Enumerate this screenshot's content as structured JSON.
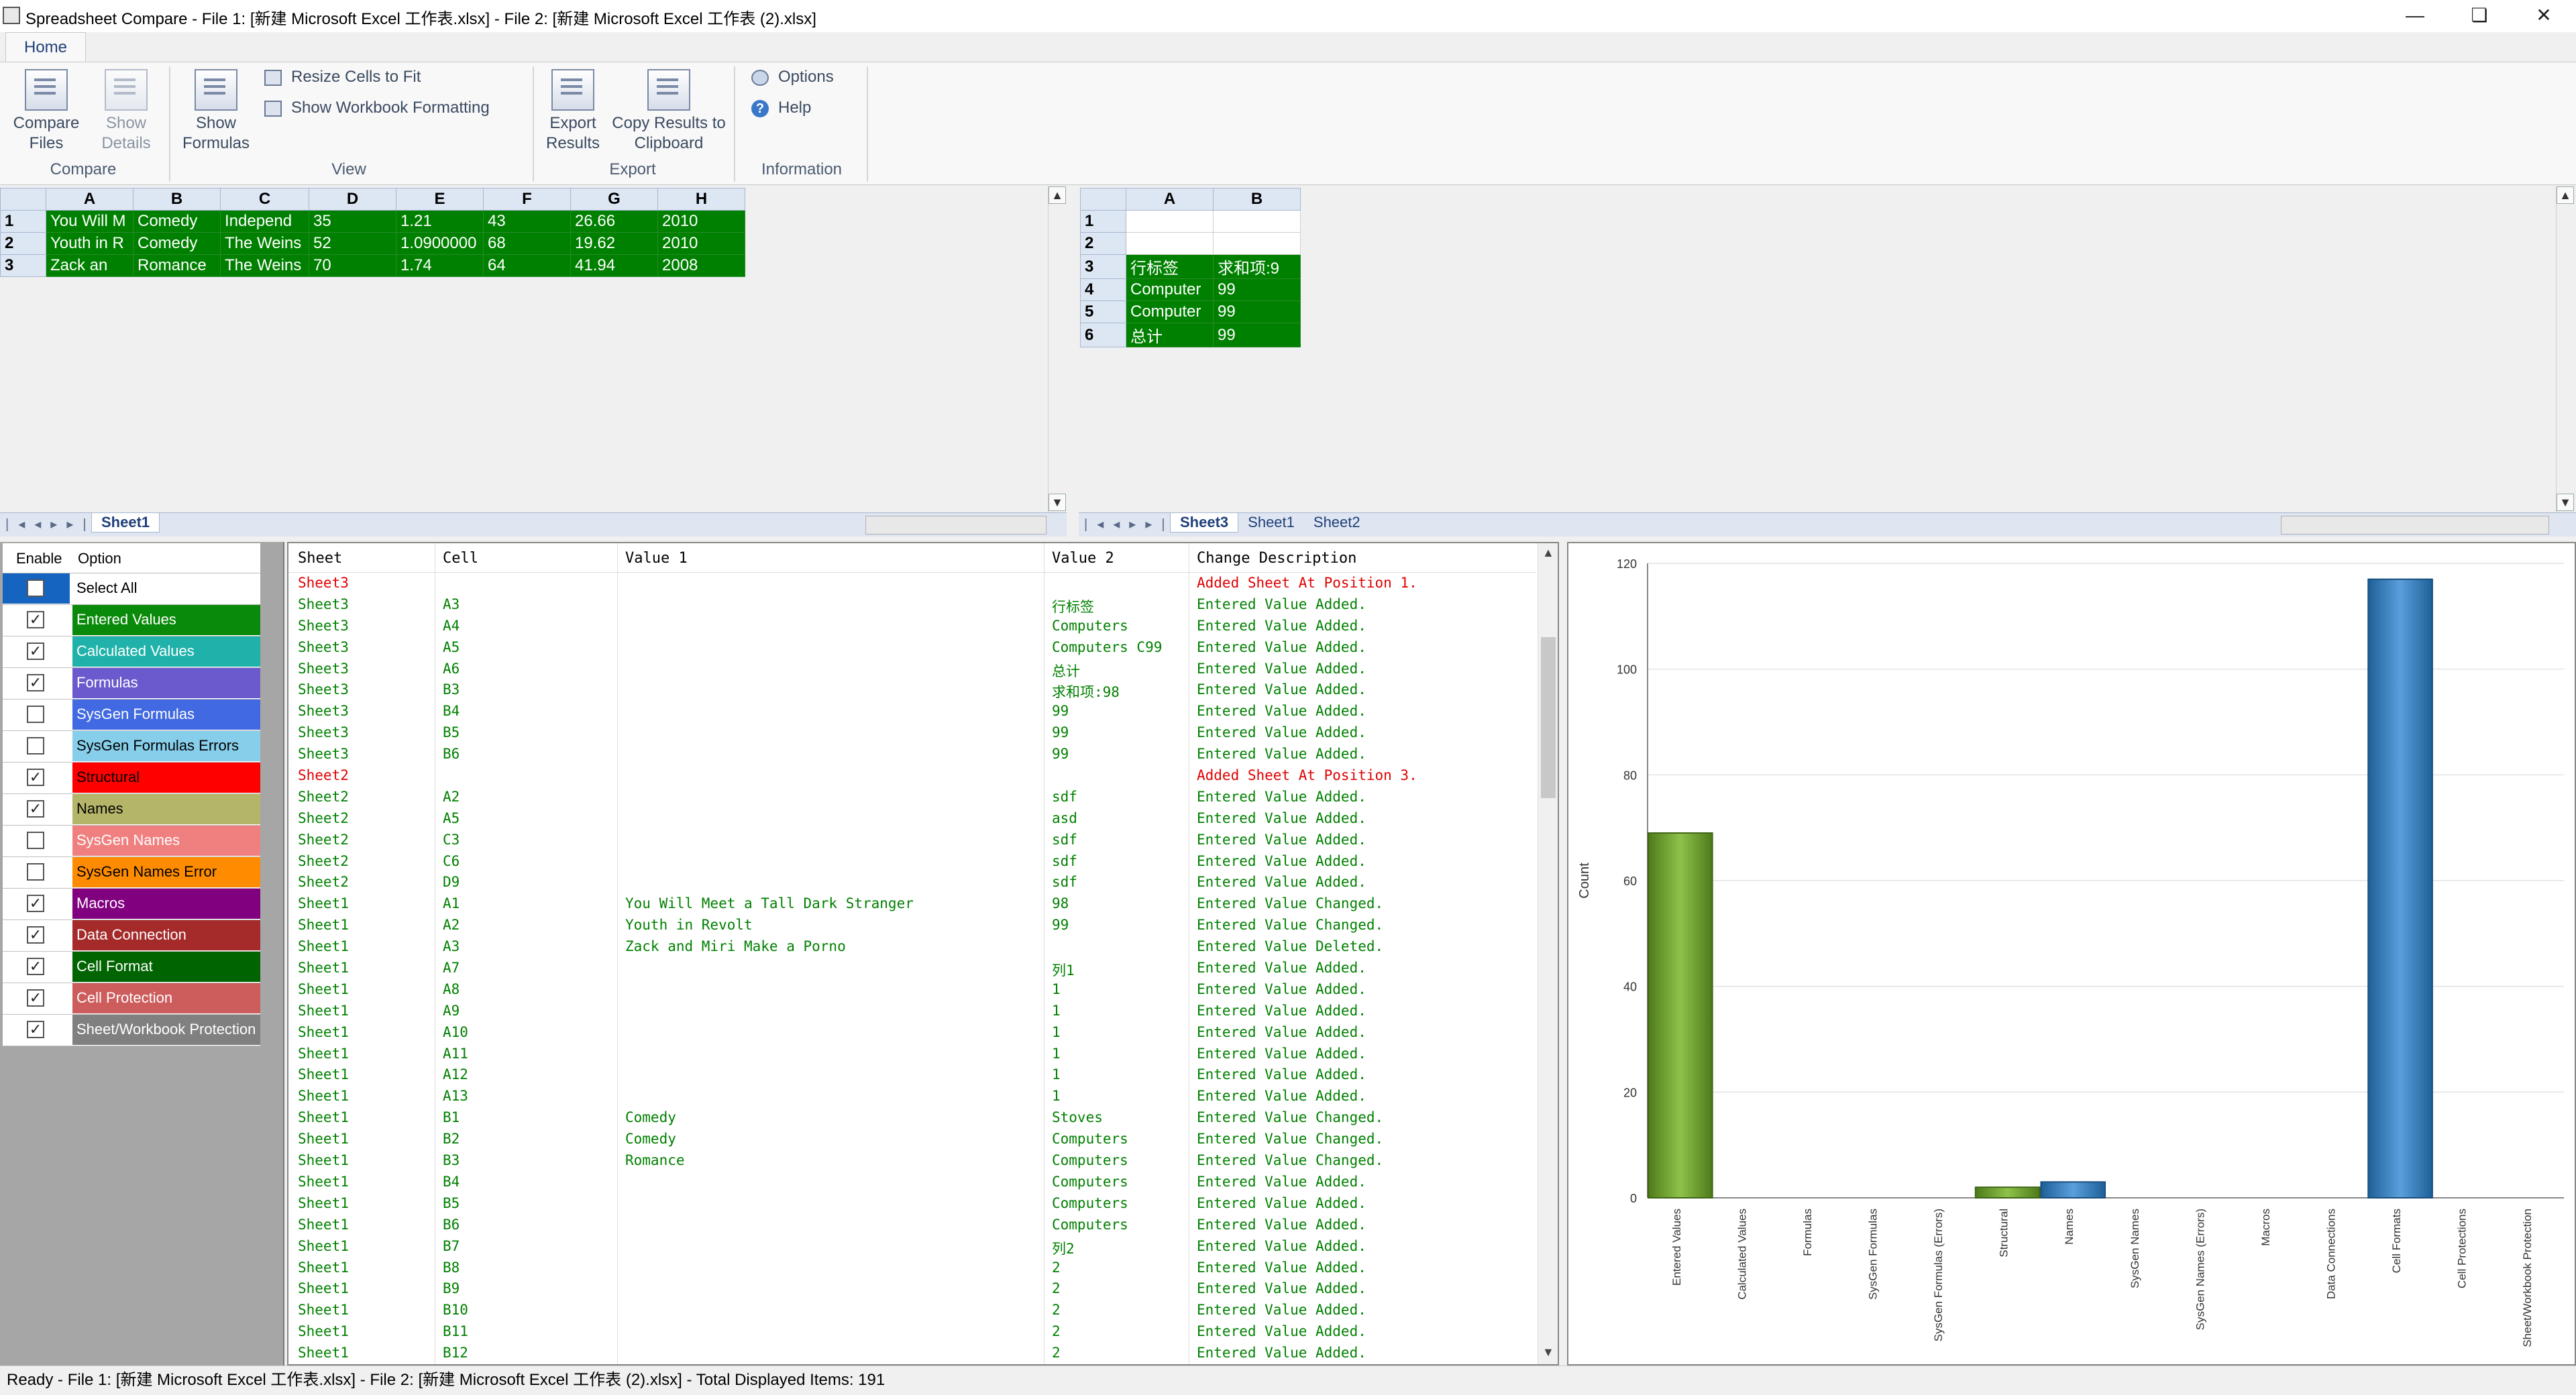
{
  "window": {
    "title": "Spreadsheet Compare - File 1: [新建 Microsoft Excel 工作表.xlsx] - File 2: [新建 Microsoft Excel 工作表 (2).xlsx]"
  },
  "ribbon": {
    "tab": "Home",
    "compare_files": "Compare Files",
    "show_details": "Show Details",
    "show_formulas": "Show Formulas",
    "resize_cells": "Resize Cells to Fit",
    "show_workbook_formatting": "Show Workbook Formatting",
    "export_results": "Export Results",
    "copy_results": "Copy Results to Clipboard",
    "options": "Options",
    "help": "Help",
    "groups": {
      "compare": "Compare",
      "view": "View",
      "export": "Export",
      "information": "Information"
    }
  },
  "left_grid": {
    "columns": [
      "A",
      "B",
      "C",
      "D",
      "E",
      "F",
      "G",
      "H"
    ],
    "rows": [
      {
        "n": "1",
        "cells": [
          "You Will M",
          "Comedy",
          "Independ",
          "35",
          "1.21",
          "43",
          "26.66",
          "2010"
        ]
      },
      {
        "n": "2",
        "cells": [
          "Youth in R",
          "Comedy",
          "The Weins",
          "52",
          "1.0900000",
          "68",
          "19.62",
          "2010"
        ]
      },
      {
        "n": "3",
        "cells": [
          "Zack an",
          "Romance",
          "The Weins",
          "70",
          "1.74",
          "64",
          "41.94",
          "2008"
        ]
      }
    ],
    "tabs": [
      "Sheet1"
    ]
  },
  "right_grid": {
    "columns": [
      "A",
      "B"
    ],
    "rows": [
      {
        "n": "1",
        "cells": [
          "",
          ""
        ],
        "hl": false
      },
      {
        "n": "2",
        "cells": [
          "",
          ""
        ],
        "hl": false
      },
      {
        "n": "3",
        "cells": [
          "行标签",
          "求和项:9"
        ],
        "hl": true
      },
      {
        "n": "4",
        "cells": [
          "Computer",
          "99"
        ],
        "hl": true
      },
      {
        "n": "5",
        "cells": [
          "Computer",
          "99"
        ],
        "hl": true
      },
      {
        "n": "6",
        "cells": [
          "总计",
          "99"
        ],
        "hl": true
      }
    ],
    "tabs": [
      "Sheet3",
      "Sheet1",
      "Sheet2"
    ]
  },
  "options_panel": {
    "header_enable": "Enable",
    "header_option": "Option",
    "items": [
      {
        "label": "Select All",
        "checked": false,
        "color": "#ffffff",
        "swatch": "#1565c0",
        "text": "#000000"
      },
      {
        "label": "Entered Values",
        "checked": true,
        "color": "#0a8a0a",
        "swatch": "",
        "text": "#ffffff"
      },
      {
        "label": "Calculated Values",
        "checked": true,
        "color": "#20b2aa",
        "swatch": "",
        "text": "#ffffff"
      },
      {
        "label": "Formulas",
        "checked": true,
        "color": "#6a5acd",
        "swatch": "",
        "text": "#ffffff"
      },
      {
        "label": "SysGen Formulas",
        "checked": false,
        "color": "#4169e1",
        "swatch": "",
        "text": "#ffffff"
      },
      {
        "label": "SysGen Formulas Errors",
        "checked": false,
        "color": "#87ceeb",
        "swatch": "",
        "text": "#000000"
      },
      {
        "label": "Structural",
        "checked": true,
        "color": "#ff0000",
        "swatch": "",
        "text": "#000000"
      },
      {
        "label": "Names",
        "checked": true,
        "color": "#b5b56a",
        "swatch": "",
        "text": "#000000"
      },
      {
        "label": "SysGen Names",
        "checked": false,
        "color": "#f08080",
        "swatch": "",
        "text": "#ffffff"
      },
      {
        "label": "SysGen Names Error",
        "checked": false,
        "color": "#ff8c00",
        "swatch": "",
        "text": "#000000"
      },
      {
        "label": "Macros",
        "checked": true,
        "color": "#800080",
        "swatch": "",
        "text": "#ffffff"
      },
      {
        "label": "Data Connection",
        "checked": true,
        "color": "#a52a2a",
        "swatch": "",
        "text": "#ffffff"
      },
      {
        "label": "Cell Format",
        "checked": true,
        "color": "#006400",
        "swatch": "",
        "text": "#ffffff"
      },
      {
        "label": "Cell Protection",
        "checked": true,
        "color": "#cd5c5c",
        "swatch": "",
        "text": "#ffffff"
      },
      {
        "label": "Sheet/Workbook Protection",
        "checked": true,
        "color": "#808080",
        "swatch": "",
        "text": "#ffffff"
      }
    ]
  },
  "results": {
    "headers": [
      "Sheet",
      "Cell",
      "Value 1",
      "Value 2",
      "Change Description"
    ],
    "rows": [
      {
        "sheet": "Sheet3",
        "cell": "",
        "v1": "",
        "v2": "",
        "desc": "Added Sheet At Position 1.",
        "red": true
      },
      {
        "sheet": "Sheet3",
        "cell": "A3",
        "v1": "",
        "v2": "行标签",
        "desc": "Entered Value Added."
      },
      {
        "sheet": "Sheet3",
        "cell": "A4",
        "v1": "",
        "v2": "Computers",
        "desc": "Entered Value Added."
      },
      {
        "sheet": "Sheet3",
        "cell": "A5",
        "v1": "",
        "v2": "Computers C99",
        "desc": "Entered Value Added."
      },
      {
        "sheet": "Sheet3",
        "cell": "A6",
        "v1": "",
        "v2": "总计",
        "desc": "Entered Value Added."
      },
      {
        "sheet": "Sheet3",
        "cell": "B3",
        "v1": "",
        "v2": "求和项:98",
        "desc": "Entered Value Added."
      },
      {
        "sheet": "Sheet3",
        "cell": "B4",
        "v1": "",
        "v2": "99",
        "desc": "Entered Value Added."
      },
      {
        "sheet": "Sheet3",
        "cell": "B5",
        "v1": "",
        "v2": "99",
        "desc": "Entered Value Added."
      },
      {
        "sheet": "Sheet3",
        "cell": "B6",
        "v1": "",
        "v2": "99",
        "desc": "Entered Value Added."
      },
      {
        "sheet": "Sheet2",
        "cell": "",
        "v1": "",
        "v2": "",
        "desc": "Added Sheet At Position 3.",
        "red": true
      },
      {
        "sheet": "Sheet2",
        "cell": "A2",
        "v1": "",
        "v2": "sdf",
        "desc": "Entered Value Added."
      },
      {
        "sheet": "Sheet2",
        "cell": "A5",
        "v1": "",
        "v2": "asd",
        "desc": "Entered Value Added."
      },
      {
        "sheet": "Sheet2",
        "cell": "C3",
        "v1": "",
        "v2": "sdf",
        "desc": "Entered Value Added."
      },
      {
        "sheet": "Sheet2",
        "cell": "C6",
        "v1": "",
        "v2": "sdf",
        "desc": "Entered Value Added."
      },
      {
        "sheet": "Sheet2",
        "cell": "D9",
        "v1": "",
        "v2": "sdf",
        "desc": "Entered Value Added."
      },
      {
        "sheet": "Sheet1",
        "cell": "A1",
        "v1": "You Will Meet a Tall Dark Stranger",
        "v2": "98",
        "desc": "Entered Value Changed."
      },
      {
        "sheet": "Sheet1",
        "cell": "A2",
        "v1": "Youth in Revolt",
        "v2": "99",
        "desc": "Entered Value Changed."
      },
      {
        "sheet": "Sheet1",
        "cell": "A3",
        "v1": "Zack and Miri Make a Porno",
        "v2": "",
        "desc": "Entered Value Deleted."
      },
      {
        "sheet": "Sheet1",
        "cell": "A7",
        "v1": "",
        "v2": "列1",
        "desc": "Entered Value Added."
      },
      {
        "sheet": "Sheet1",
        "cell": "A8",
        "v1": "",
        "v2": "1",
        "desc": "Entered Value Added."
      },
      {
        "sheet": "Sheet1",
        "cell": "A9",
        "v1": "",
        "v2": "1",
        "desc": "Entered Value Added."
      },
      {
        "sheet": "Sheet1",
        "cell": "A10",
        "v1": "",
        "v2": "1",
        "desc": "Entered Value Added."
      },
      {
        "sheet": "Sheet1",
        "cell": "A11",
        "v1": "",
        "v2": "1",
        "desc": "Entered Value Added."
      },
      {
        "sheet": "Sheet1",
        "cell": "A12",
        "v1": "",
        "v2": "1",
        "desc": "Entered Value Added."
      },
      {
        "sheet": "Sheet1",
        "cell": "A13",
        "v1": "",
        "v2": "1",
        "desc": "Entered Value Added."
      },
      {
        "sheet": "Sheet1",
        "cell": "B1",
        "v1": "Comedy",
        "v2": "Stoves",
        "desc": "Entered Value Changed."
      },
      {
        "sheet": "Sheet1",
        "cell": "B2",
        "v1": "Comedy",
        "v2": "Computers",
        "desc": "Entered Value Changed."
      },
      {
        "sheet": "Sheet1",
        "cell": "B3",
        "v1": "Romance",
        "v2": "Computers",
        "desc": "Entered Value Changed."
      },
      {
        "sheet": "Sheet1",
        "cell": "B4",
        "v1": "",
        "v2": "Computers",
        "desc": "Entered Value Added."
      },
      {
        "sheet": "Sheet1",
        "cell": "B5",
        "v1": "",
        "v2": "Computers",
        "desc": "Entered Value Added."
      },
      {
        "sheet": "Sheet1",
        "cell": "B6",
        "v1": "",
        "v2": "Computers",
        "desc": "Entered Value Added."
      },
      {
        "sheet": "Sheet1",
        "cell": "B7",
        "v1": "",
        "v2": "列2",
        "desc": "Entered Value Added."
      },
      {
        "sheet": "Sheet1",
        "cell": "B8",
        "v1": "",
        "v2": "2",
        "desc": "Entered Value Added."
      },
      {
        "sheet": "Sheet1",
        "cell": "B9",
        "v1": "",
        "v2": "2",
        "desc": "Entered Value Added."
      },
      {
        "sheet": "Sheet1",
        "cell": "B10",
        "v1": "",
        "v2": "2",
        "desc": "Entered Value Added."
      },
      {
        "sheet": "Sheet1",
        "cell": "B11",
        "v1": "",
        "v2": "2",
        "desc": "Entered Value Added."
      },
      {
        "sheet": "Sheet1",
        "cell": "B12",
        "v1": "",
        "v2": "2",
        "desc": "Entered Value Added."
      }
    ]
  },
  "chart_data": {
    "type": "bar",
    "ylabel": "Count",
    "ylim": [
      0,
      120
    ],
    "yticks": [
      0,
      20,
      40,
      60,
      80,
      100,
      120
    ],
    "categories": [
      "Entered Values",
      "Calculated Values",
      "Formulas",
      "SysGen Formulas",
      "SysGen Formulas (Errors)",
      "Structural",
      "Names",
      "SysGen Names",
      "SysGen Names (Errors)",
      "Macros",
      "Data Connections",
      "Cell Formats",
      "Cell Protections",
      "Sheet/Workbook Protection"
    ],
    "values": [
      69,
      0,
      0,
      0,
      0,
      2,
      3,
      0,
      0,
      0,
      0,
      117,
      0,
      0
    ],
    "colors": [
      "#6a9a2a",
      "#6a9a2a",
      "#6a9a2a",
      "#6a9a2a",
      "#6a9a2a",
      "#6a9a2a",
      "#2e78b5",
      "#2e78b5",
      "#2e78b5",
      "#2e78b5",
      "#2e78b5",
      "#2e78b5",
      "#2e78b5",
      "#2e78b5"
    ],
    "grid": true
  },
  "status": {
    "text": "Ready - File 1: [新建 Microsoft Excel 工作表.xlsx] - File 2: [新建 Microsoft Excel 工作表 (2).xlsx] - Total Displayed Items: 191"
  }
}
